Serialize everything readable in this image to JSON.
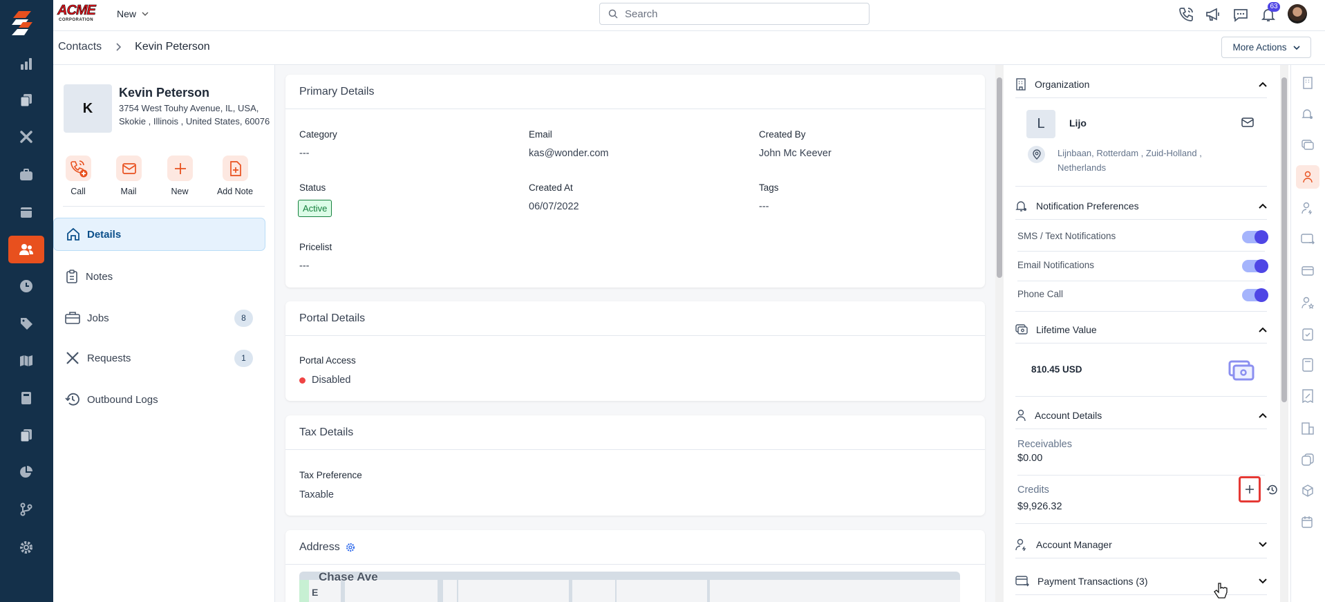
{
  "topbar": {
    "logo_text": "ACME",
    "logo_sub": "CORPORATION",
    "new_label": "New",
    "search_placeholder": "Search",
    "notification_count": "63"
  },
  "breadcrumb": {
    "parent": "Contacts",
    "current": "Kevin Peterson"
  },
  "more_actions_label": "More Actions",
  "contact": {
    "initial": "K",
    "name": "Kevin Peterson",
    "address_line1": "3754 West Touhy Avenue, IL, USA,",
    "address_line2": "Skokie , Illinois , United States, 60076",
    "actions": [
      {
        "label": "Call"
      },
      {
        "label": "Mail"
      },
      {
        "label": "New"
      },
      {
        "label": "Add Note"
      }
    ]
  },
  "nav": [
    {
      "label": "Details"
    },
    {
      "label": "Notes"
    },
    {
      "label": "Jobs",
      "count": "8"
    },
    {
      "label": "Requests",
      "count": "1"
    },
    {
      "label": "Outbound Logs"
    }
  ],
  "primary": {
    "title": "Primary Details",
    "category_label": "Category",
    "category": "---",
    "email_label": "Email",
    "email": "kas@wonder.com",
    "created_by_label": "Created By",
    "created_by": "John Mc Keever",
    "status_label": "Status",
    "status": "Active",
    "created_at_label": "Created At",
    "created_at": "06/07/2022",
    "tags_label": "Tags",
    "tags": "---",
    "pricelist_label": "Pricelist",
    "pricelist": "---"
  },
  "portal": {
    "title": "Portal Details",
    "access_label": "Portal Access",
    "access": "Disabled"
  },
  "tax": {
    "title": "Tax Details",
    "pref_label": "Tax Preference",
    "pref": "Taxable"
  },
  "address": {
    "title": "Address",
    "map_street": "Chase Ave",
    "map_letter": "E"
  },
  "right": {
    "org": {
      "title": "Organization",
      "initial": "L",
      "name": "Lijo",
      "address_line1": "Lijnbaan, Rotterdam , Zuid-Holland ,",
      "address_line2": "Netherlands"
    },
    "notif": {
      "title": "Notification Preferences",
      "items": [
        {
          "label": "SMS / Text Notifications",
          "on": true
        },
        {
          "label": "Email Notifications",
          "on": true
        },
        {
          "label": "Phone Call",
          "on": true
        }
      ]
    },
    "ltv": {
      "title": "Lifetime Value",
      "value": "810.45 USD"
    },
    "account": {
      "title": "Account Details",
      "receivables_label": "Receivables",
      "receivables": "$0.00",
      "credits_label": "Credits",
      "credits": "$9,926.32"
    },
    "manager": {
      "title": "Account Manager"
    },
    "payments": {
      "title": "Payment Transactions (3)"
    }
  },
  "colors": {
    "rail": "#14304a",
    "accent": "#e8501e",
    "toggle": "#4f46e5",
    "active_status": "#15803d"
  }
}
